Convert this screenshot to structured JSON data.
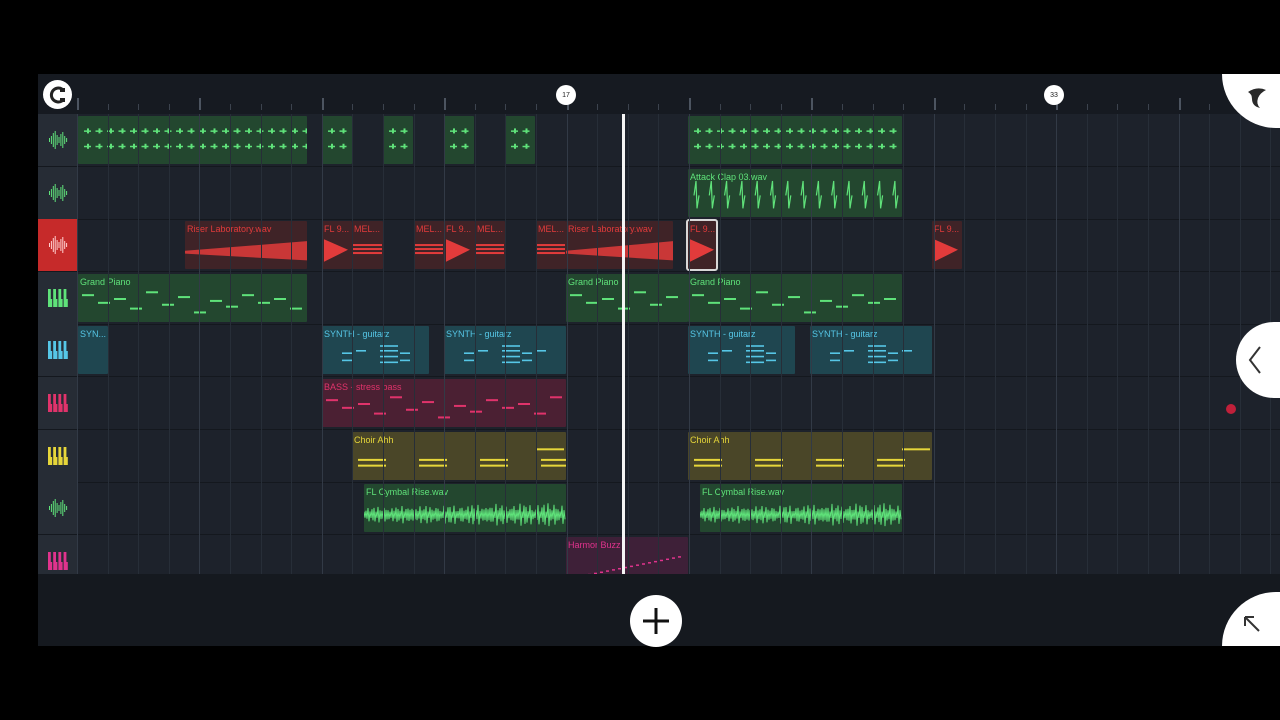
{
  "timeline": {
    "markers": [
      "17",
      "33"
    ]
  },
  "colors": {
    "green": "#5fe27a",
    "red": "#e23b3b",
    "cyan": "#56c6e6",
    "pink": "#e0336b",
    "yellow": "#e6d63a",
    "magenta": "#e0338d"
  },
  "tracks": [
    {
      "icon": "waveform-icon",
      "color": "green",
      "clips": []
    },
    {
      "icon": "waveform-icon",
      "color": "green",
      "clips": [
        {
          "label": "Attack Clap 03.wav"
        }
      ]
    },
    {
      "icon": "waveform-icon",
      "color": "red",
      "clips": [
        {
          "label": "Riser Laboratory.wav"
        },
        {
          "label": "FL 9..."
        },
        {
          "label": "MEL..."
        },
        {
          "label": "MEL..."
        },
        {
          "label": "FL 9..."
        },
        {
          "label": "MEL..."
        },
        {
          "label": "MEL..."
        },
        {
          "label": "Riser Laboratory.wav"
        },
        {
          "label": "FL 9..."
        },
        {
          "label": "FL 9..."
        }
      ]
    },
    {
      "icon": "piano-icon",
      "color": "green",
      "clips": [
        {
          "label": "Grand Piano"
        },
        {
          "label": "Grand Piano"
        },
        {
          "label": "Grand Piano"
        }
      ]
    },
    {
      "icon": "piano-icon",
      "color": "cyan",
      "clips": [
        {
          "label": "SYN..."
        },
        {
          "label": "SYNTH - guitarz"
        },
        {
          "label": "SYNTH - guitarz"
        },
        {
          "label": "SYNTH - guitarz"
        },
        {
          "label": "SYNTH - guitarz"
        }
      ]
    },
    {
      "icon": "piano-icon",
      "color": "pink",
      "clips": [
        {
          "label": "BASS - stress bass"
        }
      ]
    },
    {
      "icon": "piano-icon",
      "color": "yellow",
      "clips": [
        {
          "label": "Choir Ahh"
        },
        {
          "label": "Choir Ahh"
        }
      ]
    },
    {
      "icon": "waveform-icon",
      "color": "green",
      "clips": [
        {
          "label": "FL Cymbal Rise.wav"
        },
        {
          "label": "FL Cymbal Rise.wav"
        }
      ]
    },
    {
      "icon": "piano-icon",
      "color": "magenta",
      "clips": [
        {
          "label": "Harmor Buzz"
        }
      ]
    }
  ],
  "buttons": {
    "add": "add-track-icon",
    "collapse": "chevron-left-icon",
    "expand": "arrow-up-left-icon",
    "logo": "fl-logo-icon",
    "menu": "fruit-menu-icon"
  }
}
